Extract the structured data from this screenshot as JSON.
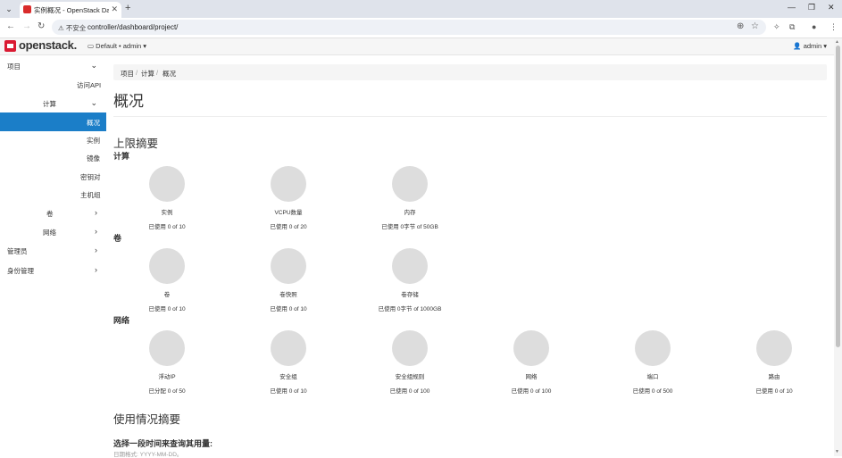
{
  "browser": {
    "tab_title": "实例概况 - OpenStack Dashb",
    "security_label": "不安全",
    "url": "controller/dashboard/project/"
  },
  "navbar": {
    "brand": "openstack.",
    "project_selector": "Default • admin",
    "user": "admin"
  },
  "sidebar": {
    "project": "项目",
    "api_access": "访问API",
    "compute": "计算",
    "overview": "概况",
    "instances": "实例",
    "images": "镜像",
    "keypairs": "密钥对",
    "server_groups": "主机组",
    "volumes": "卷",
    "network": "网络",
    "admin": "管理员",
    "identity": "身份管理"
  },
  "breadcrumb": [
    "项目",
    "计算",
    "概况"
  ],
  "page_title": "概况",
  "limits": {
    "title": "上限摘要",
    "compute": {
      "title": "计算",
      "items": [
        {
          "name": "实例",
          "usage": "已使用 0 of 10",
          "used": 0,
          "limit": 10
        },
        {
          "name": "VCPU数量",
          "usage": "已使用 0 of 20",
          "used": 0,
          "limit": 20
        },
        {
          "name": "内存",
          "usage": "已使用 0字节 of 50GB",
          "used": 0,
          "limit": 50
        }
      ]
    },
    "volume": {
      "title": "卷",
      "items": [
        {
          "name": "卷",
          "usage": "已使用 0 of 10",
          "used": 0,
          "limit": 10
        },
        {
          "name": "卷快照",
          "usage": "已使用 0 of 10",
          "used": 0,
          "limit": 10
        },
        {
          "name": "卷存储",
          "usage": "已使用 0字节 of 1000GB",
          "used": 0,
          "limit": 1000
        }
      ]
    },
    "network": {
      "title": "网络",
      "items": [
        {
          "name": "浮动IP",
          "usage": "已分配 0 of 50",
          "used": 0,
          "limit": 50
        },
        {
          "name": "安全组",
          "usage": "已使用 0 of 10",
          "used": 0,
          "limit": 10
        },
        {
          "name": "安全组规则",
          "usage": "已使用 0 of 100",
          "used": 0,
          "limit": 100
        },
        {
          "name": "网络",
          "usage": "已使用 0 of 100",
          "used": 0,
          "limit": 100
        },
        {
          "name": "端口",
          "usage": "已使用 0 of 500",
          "used": 0,
          "limit": 500
        },
        {
          "name": "路由",
          "usage": "已使用 0 of 10",
          "used": 0,
          "limit": 10
        }
      ]
    }
  },
  "usage": {
    "title": "使用情况摘要",
    "query_label": "选择一段时间来查询其用量:",
    "date_hint": "日期格式: YYYY-MM-DD。"
  },
  "colors": {
    "active_nav": "#1b7ec8",
    "brand_red": "#da1a32",
    "pie_empty": "#dddddd"
  }
}
